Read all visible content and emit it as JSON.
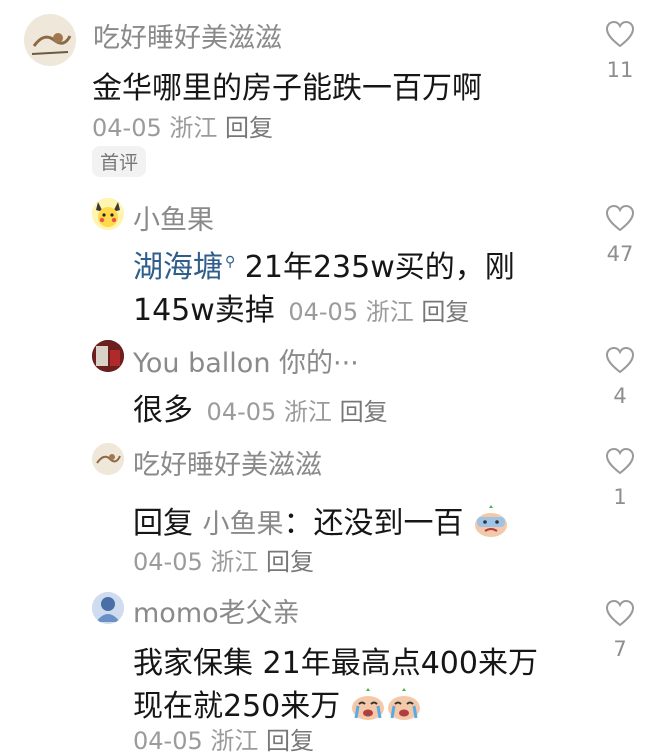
{
  "comments": [
    {
      "username": "吃好睡好美滋滋",
      "text": "金华哪里的房子能跌一百万啊",
      "date": "04-05",
      "location": "浙江",
      "reply_label": "回复",
      "badge": "首评",
      "likes": "11"
    },
    {
      "username": "小鱼果",
      "link_text": "湖海塘",
      "text_line1": " 21年235w买的，刚",
      "text_line2": "145w卖掉",
      "date": "04-05",
      "location": "浙江",
      "reply_label": "回复",
      "likes": "47"
    },
    {
      "username": "You ballon 你的···",
      "text": "很多",
      "date": "04-05",
      "location": "浙江",
      "reply_label": "回复",
      "likes": "4"
    },
    {
      "username": "吃好睡好美滋滋",
      "reply_prefix": "回复",
      "reply_to": "小鱼果",
      "text": "：还没到一百",
      "date": "04-05",
      "location": "浙江",
      "reply_label": "回复",
      "likes": "1"
    },
    {
      "username": "momo老父亲",
      "text_line1": "我家保集 21年最高点400来万",
      "text_line2": "现在就250来万",
      "date": "04-05",
      "location": "浙江",
      "reply_label": "回复",
      "likes": "7"
    }
  ],
  "colors": {
    "username": "#8a8a8a",
    "link": "#2f5d8c",
    "meta": "#9b9b9b"
  },
  "icons": {
    "like": "heart-outline-icon",
    "search": "search-icon",
    "emoji_crying": "crying-face-emoji",
    "emoji_sweat": "sweating-face-emoji"
  }
}
